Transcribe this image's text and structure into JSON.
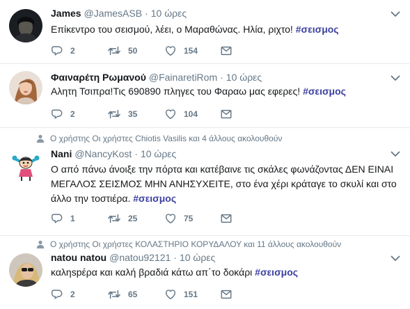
{
  "colors": {
    "hashtag": "#3b3f9f",
    "meta_text": "#657786",
    "divider": "#e6ecf0"
  },
  "tweets": [
    {
      "name": "James",
      "handle": "@JamesASB",
      "dot": "·",
      "time": "10 ώρες",
      "text": "Επίκεντρο του σεισμού, λέει, ο Μαραθώνας. Ηλία, ριχτο! ",
      "hashtag": "#σεισμος",
      "replies": "2",
      "retweets": "50",
      "likes": "154"
    },
    {
      "name": "Φαιναρέτη Ρωμανού",
      "handle": "@FainaretiRom",
      "dot": "·",
      "time": "10 ώρες",
      "text": "Αλητη Τσιπρα!Τις 690890 πληγες του Φαραω μας εφερες! ",
      "hashtag": "#σεισμος",
      "replies": "2",
      "retweets": "35",
      "likes": "104"
    },
    {
      "context": "Ο χρήστης Οι χρήστες Chiotis Vasilis και 4 άλλους ακολουθούν",
      "name": "Nani",
      "handle": "@NancyKost",
      "dot": "·",
      "time": "10 ώρες",
      "text": "Ο από πάνω άνοιξε την πόρτα και κατέβαινε τις σκάλες φωνάζοντας ΔΕΝ ΕΙΝΑΙ ΜΕΓΑΛΟΣ ΣΕΙΣΜΟΣ ΜΗΝ ΑΝΗΣΥΧΕΙΤΕ, στο ένα χέρι κράταγε το σκυλί και στο άλλο την τοστιέρα. ",
      "hashtag": "#σεισμος",
      "replies": "1",
      "retweets": "25",
      "likes": "75"
    },
    {
      "context": "Ο χρήστης Οι χρήστες ΚΟΛΑΣΤΗΡΙΟ ΚΟΡΥΔΑΛΟΥ και 11 άλλους ακολουθούν",
      "name": "natou natou",
      "handle": "@natou92121",
      "dot": "·",
      "time": "10 ώρες",
      "text": "καληspέρα και καλή βραδιά κάτω απ΄το δοκάρι ",
      "hashtag": "#σεισμος",
      "replies": "2",
      "retweets": "65",
      "likes": "151"
    }
  ]
}
